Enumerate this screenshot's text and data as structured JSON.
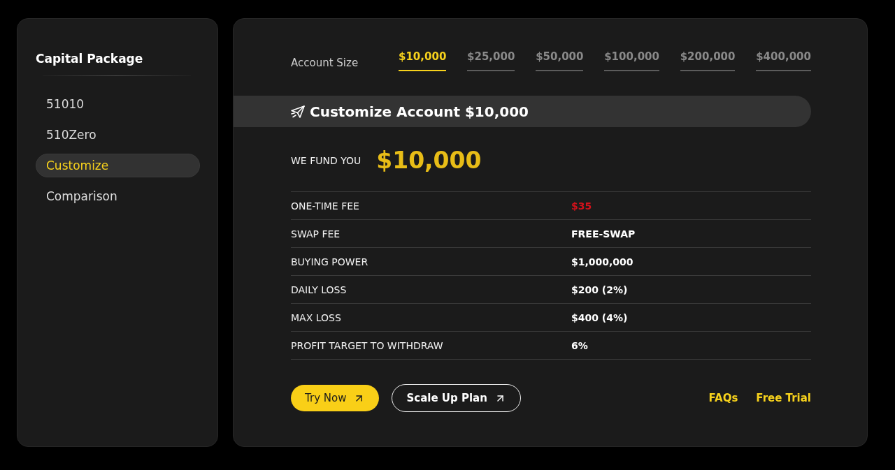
{
  "sidebar": {
    "title": "Capital Package",
    "items": [
      {
        "label": "51010",
        "selected": false
      },
      {
        "label": "510Zero",
        "selected": false
      },
      {
        "label": "Customize",
        "selected": true
      },
      {
        "label": "Comparison",
        "selected": false
      }
    ]
  },
  "account_size": {
    "label": "Account Size",
    "tabs": [
      {
        "label": "$10,000",
        "selected": true
      },
      {
        "label": "$25,000",
        "selected": false
      },
      {
        "label": "$50,000",
        "selected": false
      },
      {
        "label": "$100,000",
        "selected": false
      },
      {
        "label": "$200,000",
        "selected": false
      },
      {
        "label": "$400,000",
        "selected": false
      }
    ]
  },
  "header": {
    "title": "Customize Account $10,000"
  },
  "funding": {
    "label": "WE FUND YOU",
    "amount": "$10,000"
  },
  "table": {
    "rows": [
      {
        "label": "ONE-TIME FEE",
        "value": "$35",
        "color": "#d0121b"
      },
      {
        "label": "SWAP FEE",
        "value": "FREE-SWAP",
        "color": "#ffffff"
      },
      {
        "label": "BUYING POWER",
        "value": "$1,000,000",
        "color": "#ffffff"
      },
      {
        "label": "DAILY LOSS",
        "value": "$200 (2%)",
        "color": "#ffffff"
      },
      {
        "label": "MAX LOSS",
        "value": "$400 (4%)",
        "color": "#ffffff"
      },
      {
        "label": "PROFIT TARGET TO WITHDRAW",
        "value": "6%",
        "color": "#ffffff"
      }
    ]
  },
  "buttons": [
    {
      "label": "Try Now",
      "kind": "primary"
    },
    {
      "label": "Scale Up Plan",
      "kind": "outline"
    }
  ],
  "links": [
    {
      "label": "FAQs"
    },
    {
      "label": "Free Trial"
    }
  ]
}
